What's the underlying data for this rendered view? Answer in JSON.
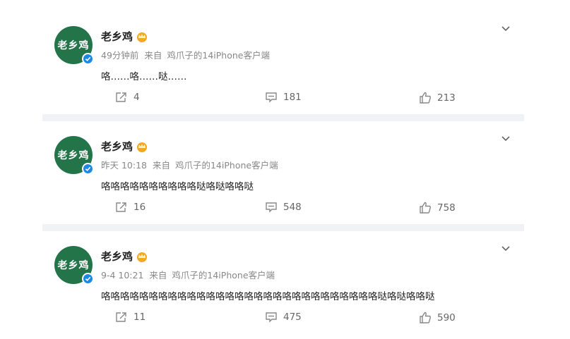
{
  "posts": [
    {
      "avatar_text": "老乡鸡",
      "name": "老乡鸡",
      "time": "49分钟前",
      "from_label": "来自",
      "source": "鸡爪子的14iPhone客户端",
      "text": "咯……咯……哒……",
      "reposts": "4",
      "comments": "181",
      "likes": "213"
    },
    {
      "avatar_text": "老乡鸡",
      "name": "老乡鸡",
      "time": "昨天 10:18",
      "from_label": "来自",
      "source": "鸡爪子的14iPhone客户端",
      "text": "咯咯咯咯咯咯咯咯咯咯哒咯哒咯咯哒",
      "reposts": "16",
      "comments": "548",
      "likes": "758"
    },
    {
      "avatar_text": "老乡鸡",
      "name": "老乡鸡",
      "time": "9-4 10:21",
      "from_label": "来自",
      "source": "鸡爪子的14iPhone客户端",
      "text": "咯咯咯咯咯咯咯咯咯咯咯咯咯咯咯咯咯咯咯咯咯咯咯咯咯咯咯咯咯哒咯哒咯咯哒",
      "reposts": "11",
      "comments": "475",
      "likes": "590"
    }
  ],
  "icons": {
    "crown": "crown-icon",
    "verified": "verified-icon",
    "menu": "chevron-down-icon",
    "repost": "repost-icon",
    "comment": "comment-icon",
    "like": "like-icon"
  },
  "colors": {
    "avatar_bg": "#24744a",
    "verified": "#1e88e5",
    "crown": "#f5a623",
    "separator": "#f1f2f5"
  }
}
